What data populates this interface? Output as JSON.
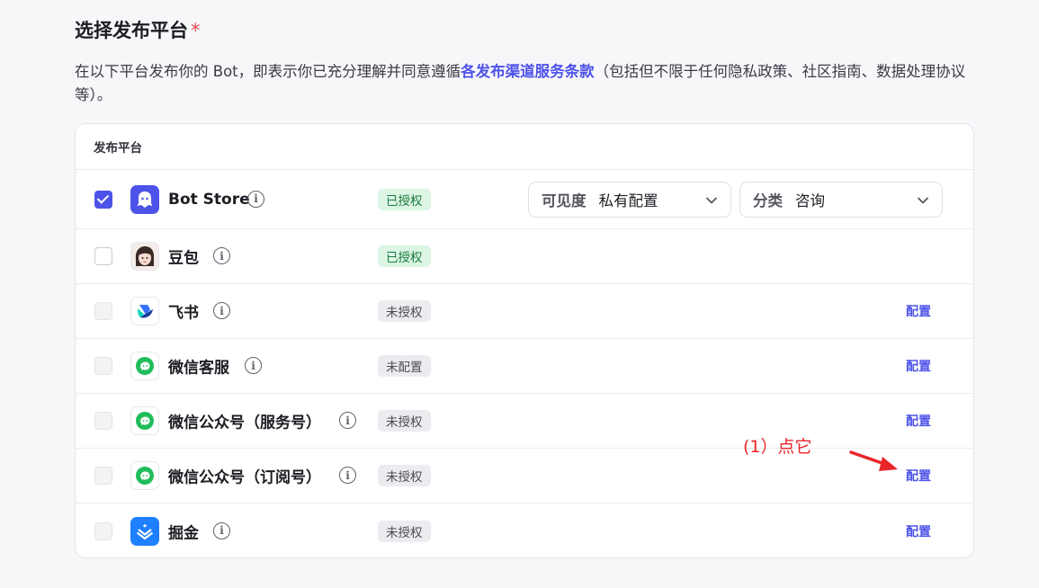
{
  "section": {
    "title": "选择发布平台",
    "required_mark": "*",
    "description_before": "在以下平台发布你的 Bot，即表示你已充分理解并同意遵循",
    "description_link": "各发布渠道服务条款",
    "description_after": "（包括但不限于任何隐私政策、社区指南、数据处理协议等）。"
  },
  "table": {
    "header": "发布平台",
    "rows": [
      {
        "name": "Bot Store",
        "checked": true,
        "status": "已授权",
        "status_type": "authorized",
        "icon": "bot-store-icon"
      },
      {
        "name": "豆包",
        "checked": false,
        "status": "已授权",
        "status_type": "authorized",
        "icon": "doubao-avatar-icon"
      },
      {
        "name": "飞书",
        "checked": false,
        "disabled": true,
        "status": "未授权",
        "status_type": "unauthorized",
        "action": "配置",
        "icon": "feishu-icon"
      },
      {
        "name": "微信客服",
        "checked": false,
        "disabled": true,
        "status": "未配置",
        "status_type": "unconfigured",
        "action": "配置",
        "icon": "wechat-icon"
      },
      {
        "name": "微信公众号（服务号）",
        "checked": false,
        "disabled": true,
        "status": "未授权",
        "status_type": "unauthorized",
        "action": "配置",
        "icon": "wechat-icon"
      },
      {
        "name": "微信公众号（订阅号）",
        "checked": false,
        "disabled": true,
        "status": "未授权",
        "status_type": "unauthorized",
        "action": "配置",
        "icon": "wechat-icon"
      },
      {
        "name": "掘金",
        "checked": false,
        "disabled": true,
        "status": "未授权",
        "status_type": "unauthorized",
        "action": "配置",
        "icon": "juejin-icon"
      }
    ],
    "visibility_select": {
      "label": "可见度",
      "value": "私有配置"
    },
    "category_select": {
      "label": "分类",
      "value": "咨询"
    },
    "info_glyph": "i"
  },
  "annotation": {
    "text": "(1）点它"
  },
  "colors": {
    "accent": "#4d53e8",
    "annotation": "#e8262a",
    "authorized_bg": "#dcf5e4",
    "unauthorized_bg": "#ebecef"
  }
}
